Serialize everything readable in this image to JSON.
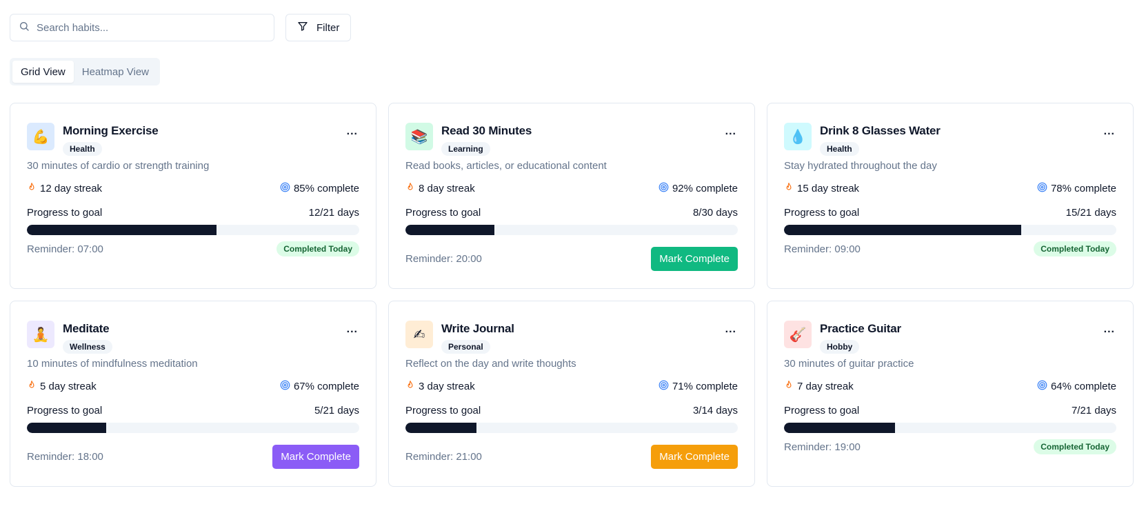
{
  "search": {
    "placeholder": "Search habits...",
    "icon": "search-icon"
  },
  "filter": {
    "label": "Filter",
    "icon": "filter-icon"
  },
  "tabs": [
    {
      "label": "Grid View",
      "active": true
    },
    {
      "label": "Heatmap View",
      "active": false
    }
  ],
  "colors": {
    "streak_flame": "#f97316",
    "target": "#3b82f6",
    "progress_fill": "#0f172a",
    "completed_bg": "#dcfce7",
    "completed_text": "#166534"
  },
  "habits": [
    {
      "title": "Morning Exercise",
      "category": "Health",
      "emoji": "💪",
      "icon_bg": "#dbeafe",
      "description": "30 minutes of cardio or strength training",
      "streak": "12 day streak",
      "complete": "85% complete",
      "progress_label": "Progress to goal",
      "progress_text": "12/21 days",
      "progress": 0.5714,
      "reminder": "Reminder: 07:00",
      "status": "done",
      "status_label": "Completed Today",
      "more": "..."
    },
    {
      "title": "Read 30 Minutes",
      "category": "Learning",
      "emoji": "📚",
      "icon_bg": "#d1fae5",
      "description": "Read books, articles, or educational content",
      "streak": "8 day streak",
      "complete": "92% complete",
      "progress_label": "Progress to goal",
      "progress_text": "8/30 days",
      "progress": 0.2667,
      "reminder": "Reminder: 20:00",
      "status": "action",
      "status_label": "Mark Complete",
      "button_color": "#10b981",
      "more": "..."
    },
    {
      "title": "Drink 8 Glasses Water",
      "category": "Health",
      "emoji": "💧",
      "icon_bg": "#cffafe",
      "description": "Stay hydrated throughout the day",
      "streak": "15 day streak",
      "complete": "78% complete",
      "progress_label": "Progress to goal",
      "progress_text": "15/21 days",
      "progress": 0.7143,
      "reminder": "Reminder: 09:00",
      "status": "done",
      "status_label": "Completed Today",
      "more": "..."
    },
    {
      "title": "Meditate",
      "category": "Wellness",
      "emoji": "🧘",
      "icon_bg": "#ede9fe",
      "description": "10 minutes of mindfulness meditation",
      "streak": "5 day streak",
      "complete": "67% complete",
      "progress_label": "Progress to goal",
      "progress_text": "5/21 days",
      "progress": 0.2381,
      "reminder": "Reminder: 18:00",
      "status": "action",
      "status_label": "Mark Complete",
      "button_color": "#8b5cf6",
      "more": "..."
    },
    {
      "title": "Write Journal",
      "category": "Personal",
      "emoji": "✍",
      "icon_bg": "#ffedd5",
      "description": "Reflect on the day and write thoughts",
      "streak": "3 day streak",
      "complete": "71% complete",
      "progress_label": "Progress to goal",
      "progress_text": "3/14 days",
      "progress": 0.2143,
      "reminder": "Reminder: 21:00",
      "status": "action",
      "status_label": "Mark Complete",
      "button_color": "#f59e0b",
      "more": "..."
    },
    {
      "title": "Practice Guitar",
      "category": "Hobby",
      "emoji": "🎸",
      "icon_bg": "#fee2e2",
      "description": "30 minutes of guitar practice",
      "streak": "7 day streak",
      "complete": "64% complete",
      "progress_label": "Progress to goal",
      "progress_text": "7/21 days",
      "progress": 0.3333,
      "reminder": "Reminder: 19:00",
      "status": "done",
      "status_label": "Completed Today",
      "more": "..."
    }
  ]
}
